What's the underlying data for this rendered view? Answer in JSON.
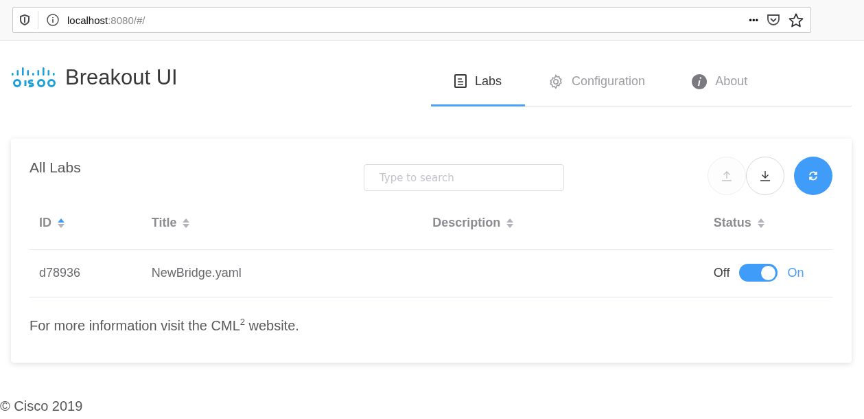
{
  "browser": {
    "url_host": "localhost",
    "url_rest": ":8080/#/",
    "menu": "•••"
  },
  "header": {
    "title": "Breakout UI"
  },
  "tabs": [
    {
      "label": "Labs",
      "kind": "document",
      "selected": true
    },
    {
      "label": "Configuration",
      "kind": "gear",
      "selected": false
    },
    {
      "label": "About",
      "kind": "info",
      "selected": false
    }
  ],
  "card": {
    "title": "All Labs",
    "search": {
      "placeholder": "Type to search"
    },
    "actions": [
      {
        "kind": "upload",
        "disabled": true,
        "primary": false
      },
      {
        "kind": "download",
        "disabled": false,
        "primary": false
      },
      {
        "kind": "refresh",
        "disabled": false,
        "primary": true
      }
    ],
    "columns": [
      {
        "label": "ID",
        "sorted": true
      },
      {
        "label": "Title",
        "sorted": false
      },
      {
        "label": "Description",
        "sorted": false
      },
      {
        "label": "Status",
        "sorted": false
      }
    ],
    "rows": [
      {
        "id": "d78936",
        "title": "NewBridge.yaml",
        "off_label": "Off",
        "on_label": "On",
        "on": true
      }
    ],
    "note": "For more information visit the CML$^{2}$ website."
  },
  "footer": "© Cisco 2019"
}
